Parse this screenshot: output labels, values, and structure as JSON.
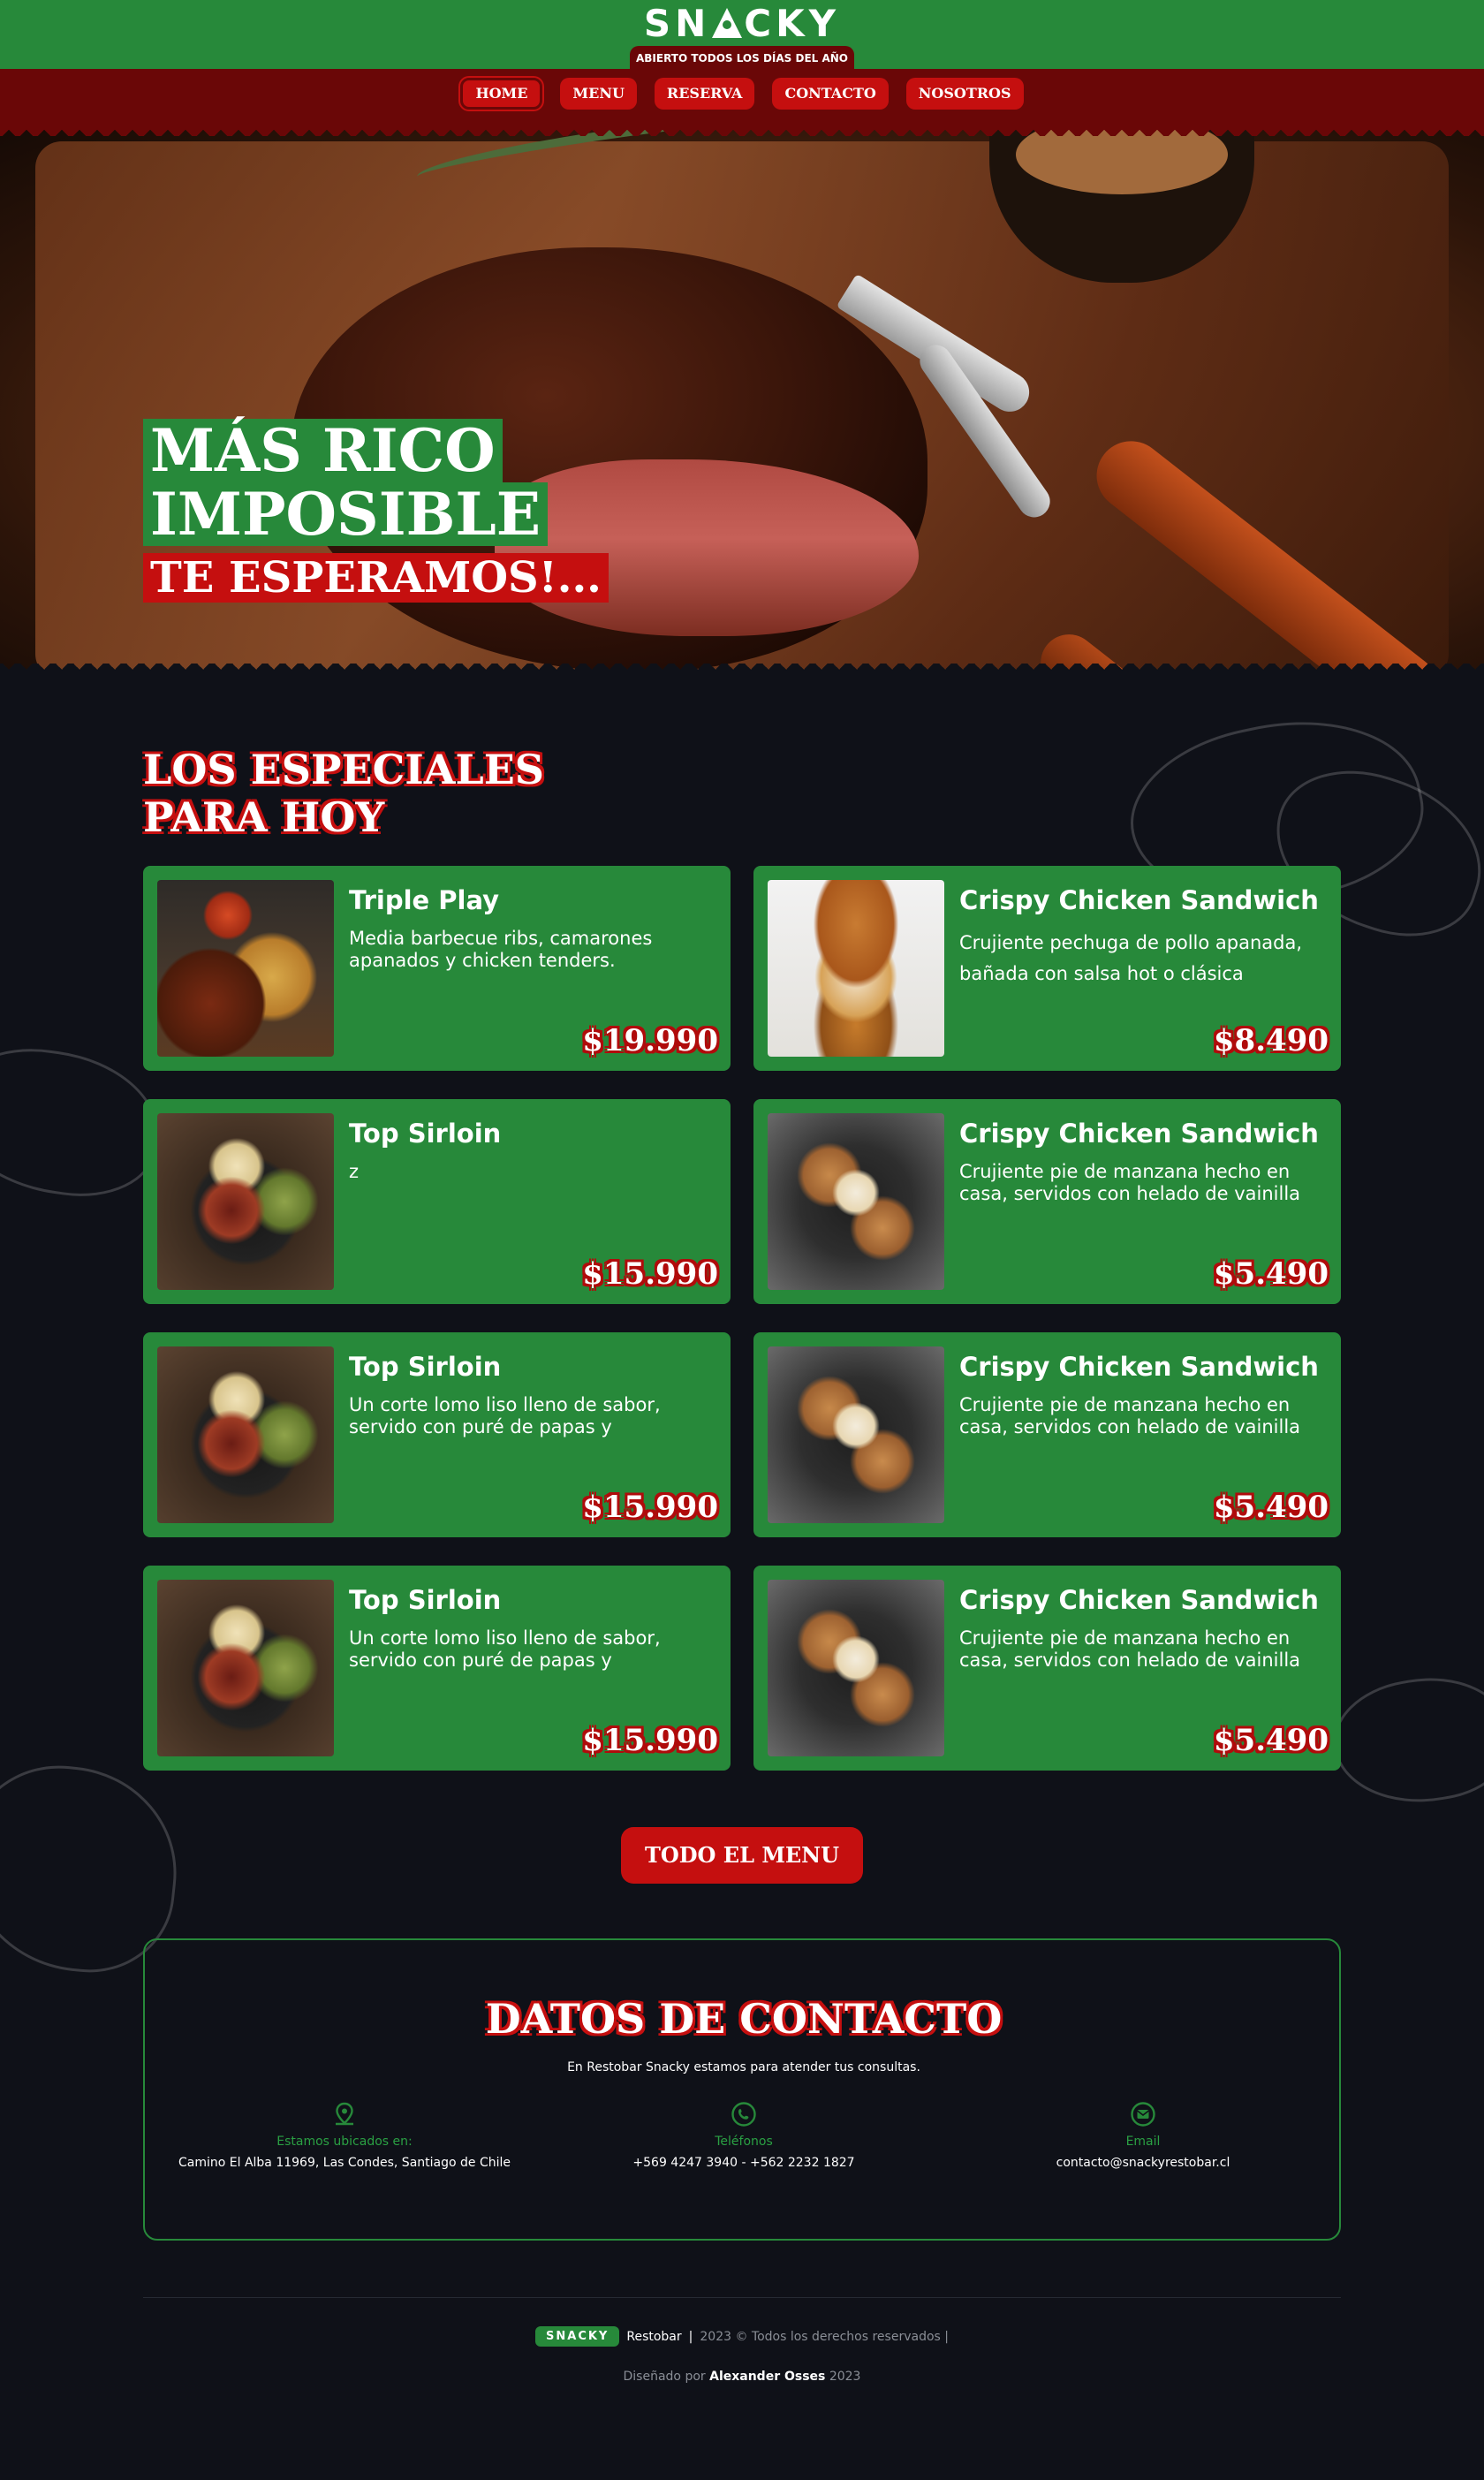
{
  "header": {
    "logo_text": "SN  CKY",
    "open_badge": "ABIERTO TODOS LOS DÍAS DEL AÑO"
  },
  "nav": {
    "items": [
      {
        "label": "HOME",
        "active": true
      },
      {
        "label": "MENU",
        "active": false
      },
      {
        "label": "RESERVA",
        "active": false
      },
      {
        "label": "CONTACTO",
        "active": false
      },
      {
        "label": "NOSOTROS",
        "active": false
      }
    ]
  },
  "hero": {
    "line1": "MÁS RICO",
    "line2": "IMPOSIBLE",
    "line3": "TE ESPERAMOS!..."
  },
  "specials": {
    "title_line1": "LOS ESPECIALES",
    "title_line2": "PARA HOY",
    "items": [
      {
        "title": "Triple Play",
        "description": "Media barbecue ribs, camarones apanados y chicken tenders.",
        "price": "$19.990",
        "image": "ribs"
      },
      {
        "title": "Crispy Chicken Sandwich",
        "description": "Crujiente pechuga de pollo apanada, bañada con salsa hot o clásica",
        "price": "$8.490",
        "image": "sandwich"
      },
      {
        "title": "Top Sirloin",
        "description": "z",
        "price": "$15.990",
        "image": "steak"
      },
      {
        "title": "Crispy Chicken Sandwich",
        "description": "Crujiente pie de manzana hecho en casa, servidos con helado de vainilla",
        "price": "$5.490",
        "image": "pie"
      },
      {
        "title": "Top Sirloin",
        "description": "Un corte lomo liso lleno de sabor, servido con puré de papas y",
        "price": "$15.990",
        "image": "steak"
      },
      {
        "title": "Crispy Chicken Sandwich",
        "description": "Crujiente pie de manzana hecho en casa, servidos con helado de vainilla",
        "price": "$5.490",
        "image": "pie"
      },
      {
        "title": "Top Sirloin",
        "description": "Un corte lomo liso lleno de sabor, servido con puré de papas y",
        "price": "$15.990",
        "image": "steak"
      },
      {
        "title": "Crispy Chicken Sandwich",
        "description": "Crujiente pie de manzana hecho en casa, servidos con helado de vainilla",
        "price": "$5.490",
        "image": "pie"
      }
    ],
    "button_label": "TODO EL MENU"
  },
  "contact": {
    "title": "DATOS DE CONTACTO",
    "subtitle": "En Restobar Snacky estamos para atender tus consultas.",
    "columns": [
      {
        "icon": "map-pin-icon",
        "label": "Estamos ubicados en:",
        "value": "Camino El Alba 11969, Las Condes, Santiago de Chile"
      },
      {
        "icon": "phone-icon",
        "label": "Teléfonos",
        "value": "+569 4247 3940 - +562 2232 1827"
      },
      {
        "icon": "email-icon",
        "label": "Email",
        "value": "contacto@snackyrestobar.cl"
      }
    ]
  },
  "footer": {
    "logo_text": "SNACKY",
    "brand": "Restobar",
    "separator": "|",
    "rights": "2023 © Todos los derechos reservados |",
    "credit_prefix": "Diseñado por",
    "credit_author": "Alexander Osses",
    "credit_year": "2023"
  },
  "colors": {
    "green": "#27893a",
    "dark_red": "#6a0707",
    "red": "#c50f0f",
    "background": "#0f1118"
  }
}
